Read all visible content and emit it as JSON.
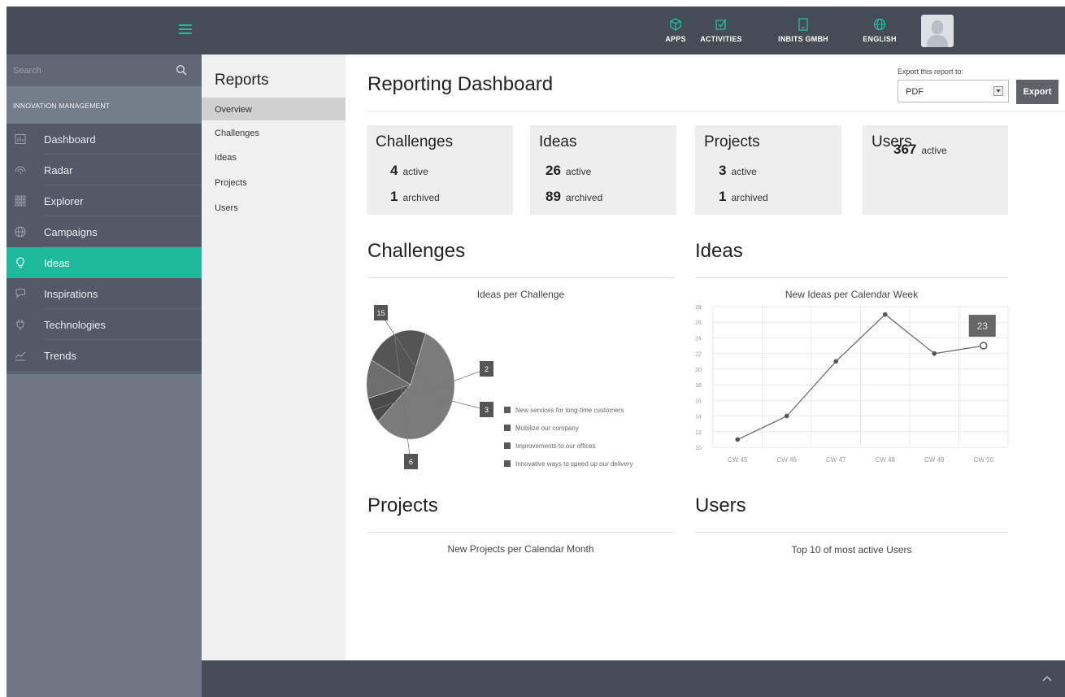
{
  "topbar": {
    "nav": [
      {
        "label": "APPS",
        "icon": "cube-icon"
      },
      {
        "label": "ACTIVITIES",
        "icon": "checkbox-icon"
      },
      {
        "label": "INBITS GMBH",
        "icon": "building-icon"
      },
      {
        "label": "ENGLISH",
        "icon": "globe-icon"
      }
    ],
    "accent_color": "#1fbfa3"
  },
  "sidebar": {
    "search_placeholder": "Search",
    "section_title": "INNOVATION MANAGEMENT",
    "items": [
      {
        "label": "Dashboard",
        "icon": "dashboard-icon"
      },
      {
        "label": "Radar",
        "icon": "radar-icon"
      },
      {
        "label": "Explorer",
        "icon": "grid-icon"
      },
      {
        "label": "Campaigns",
        "icon": "globe-icon"
      },
      {
        "label": "Ideas",
        "icon": "lightbulb-icon",
        "active": true
      },
      {
        "label": "Inspirations",
        "icon": "speech-bubble-icon"
      },
      {
        "label": "Technologies",
        "icon": "plug-icon"
      },
      {
        "label": "Trends",
        "icon": "trend-icon"
      }
    ],
    "active_color": "#1fb99d"
  },
  "subnav": {
    "title": "Reports",
    "items": [
      {
        "label": "Overview",
        "active": true
      },
      {
        "label": "Challenges"
      },
      {
        "label": "Ideas"
      },
      {
        "label": "Projects"
      },
      {
        "label": "Users"
      }
    ]
  },
  "main": {
    "title": "Reporting Dashboard",
    "export": {
      "label": "Export this report to:",
      "selected": "PDF",
      "button": "Export"
    },
    "cards": [
      {
        "title": "Challenges",
        "active": "4",
        "active_label": "active",
        "archived": "1",
        "archived_label": "archived"
      },
      {
        "title": "Ideas",
        "active": "26",
        "active_label": "active",
        "archived": "89",
        "archived_label": "archived"
      },
      {
        "title": "Projects",
        "active": "3",
        "active_label": "active",
        "archived": "1",
        "archived_label": "archived"
      },
      {
        "title": "Users",
        "active": "367",
        "active_label": "active"
      }
    ],
    "sections": {
      "challenges": "Challenges",
      "ideas": "Ideas",
      "projects": "Projects",
      "users": "Users"
    },
    "projects_chart_title": "New Projects per Calendar Month",
    "users_chart_title": "Top 10 of most active Users"
  },
  "chart_data": [
    {
      "type": "pie",
      "title": "Ideas per Challenge",
      "categories": [
        "New services for long-time customers",
        "Mobilize our company",
        "Improvements to our offices",
        "Innovative ways to speed up our delivery"
      ],
      "values": [
        15,
        2,
        3,
        6
      ],
      "colors": [
        "#7b7b7b",
        "#4a4a4a",
        "#6e6e6e",
        "#555555"
      ]
    },
    {
      "type": "line",
      "title": "New Ideas per Calendar Week",
      "x": [
        "CW 45",
        "CW 46",
        "CW 47",
        "CW 48",
        "CW 49",
        "CW 50"
      ],
      "series": [
        {
          "values": [
            11,
            14,
            21,
            27,
            22,
            23
          ]
        }
      ],
      "yticks": [
        10,
        12,
        14,
        16,
        18,
        20,
        22,
        24,
        26,
        28
      ],
      "ylim": [
        10,
        28
      ],
      "highlight_label": "23",
      "grid": true
    }
  ]
}
